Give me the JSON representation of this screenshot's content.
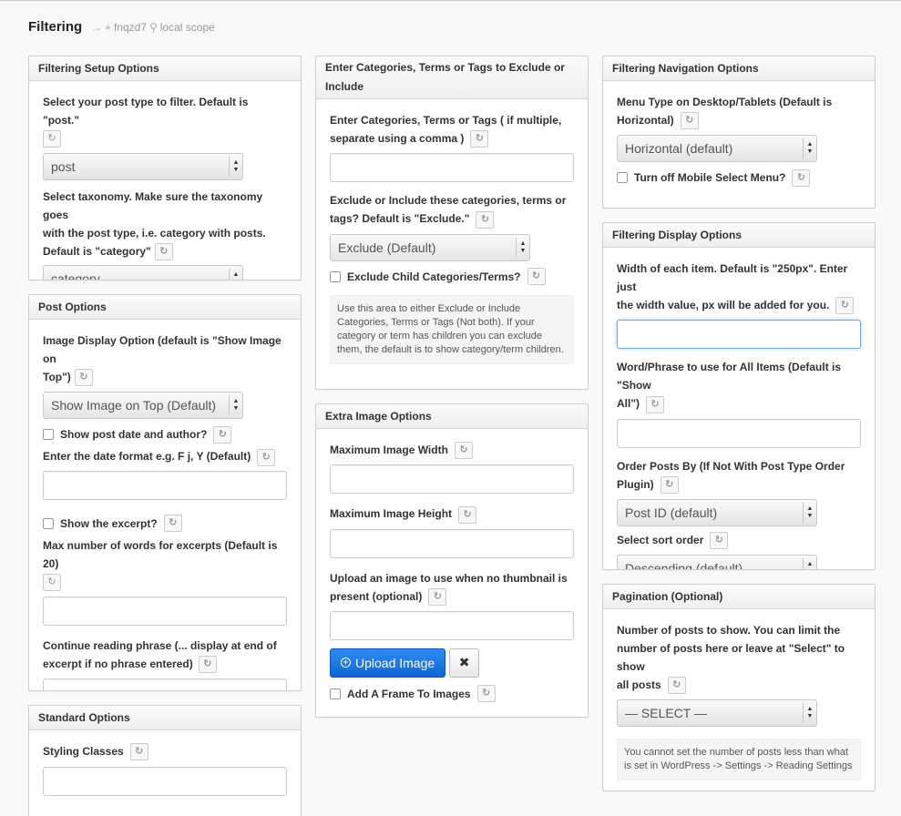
{
  "header": {
    "title": "Filtering",
    "arrow": "→",
    "hash": "fnqzd7",
    "scope": "local scope"
  },
  "icons": {
    "refresh": "↻",
    "target": "⌖",
    "pin": "⚲",
    "up": "▲",
    "down": "▼",
    "plus_circle": "+",
    "close": "✖"
  },
  "filtering_setup": {
    "title": "Filtering Setup Options",
    "post_type_label": "Select your post type to filter. Default is \"post.\"",
    "post_type_value": "post",
    "taxonomy_label_1": "Select taxonomy. Make sure the taxonomy goes",
    "taxonomy_label_2": "with the post type, i.e. category with posts.",
    "taxonomy_label_3": "Default is \"category\"",
    "taxonomy_value": "category"
  },
  "post_options": {
    "title": "Post Options",
    "image_display_label_1": "Image Display Option (default is \"Show Image on",
    "image_display_label_2": "Top\")",
    "image_display_value": "Show Image on Top (Default)",
    "show_date_label": "Show post date and author?",
    "date_format_label": "Enter the date format e.g. F j, Y (Default)",
    "show_excerpt_label": "Show the excerpt?",
    "max_words_label": "Max number of words for excerpts (Default is 20)",
    "continue_label_1": "Continue reading phrase (... display at end of",
    "continue_label_2": "excerpt if no phrase entered)"
  },
  "standard_options": {
    "title": "Standard Options",
    "styling_label": "Styling Classes"
  },
  "terms": {
    "title_1": "Enter Categories, Terms or Tags to Exclude or",
    "title_2": "Include",
    "enter_label_1": "Enter Categories, Terms or Tags ( if multiple,",
    "enter_label_2": "separate using a comma )",
    "exclude_label_1": "Exclude or Include these categories, terms or",
    "exclude_label_2": "tags? Default is \"Exclude.\"",
    "exclude_value": "Exclude (Default)",
    "exclude_child_label": "Exclude Child Categories/Terms?",
    "note": "Use this area to either Exclude or Include Categories, Terms or Tags (Not both). If your category or term has children you can exclude them, the default is to show category/term children."
  },
  "extra_image": {
    "title": "Extra Image Options",
    "max_width_label": "Maximum Image Width",
    "max_height_label": "Maximum Image Height",
    "upload_label_1": "Upload an image to use when no thumbnail is",
    "upload_label_2": "present (optional)",
    "upload_button": "Upload Image",
    "frame_label": "Add A Frame To Images"
  },
  "nav_options": {
    "title": "Filtering Navigation Options",
    "menu_type_label_1": "Menu Type on Desktop/Tablets (Default is",
    "menu_type_label_2": "Horizontal)",
    "menu_type_value": "Horizontal (default)",
    "mobile_label": "Turn off Mobile Select Menu?"
  },
  "display_options": {
    "title": "Filtering Display Options",
    "width_label_1": "Width of each item. Default is \"250px\". Enter just",
    "width_label_2": "the width value, px will be added for you.",
    "phrase_label_1": "Word/Phrase to use for All Items (Default is \"Show",
    "phrase_label_2": "All\")",
    "order_label_1": "Order Posts By (If Not With Post Type Order",
    "order_label_2": "Plugin)",
    "order_value": "Post ID (default)",
    "sort_label": "Select sort order",
    "sort_value": "Descending (default)"
  },
  "pagination": {
    "title": "Pagination (Optional)",
    "num_label_1": "Number of posts to show. You can limit the",
    "num_label_2": "number of posts here or leave at \"Select\" to show",
    "num_label_3": "all posts",
    "num_value": "— SELECT —",
    "note": "You cannot set the number of posts less than what is set in WordPress -> Settings -> Reading Settings"
  }
}
